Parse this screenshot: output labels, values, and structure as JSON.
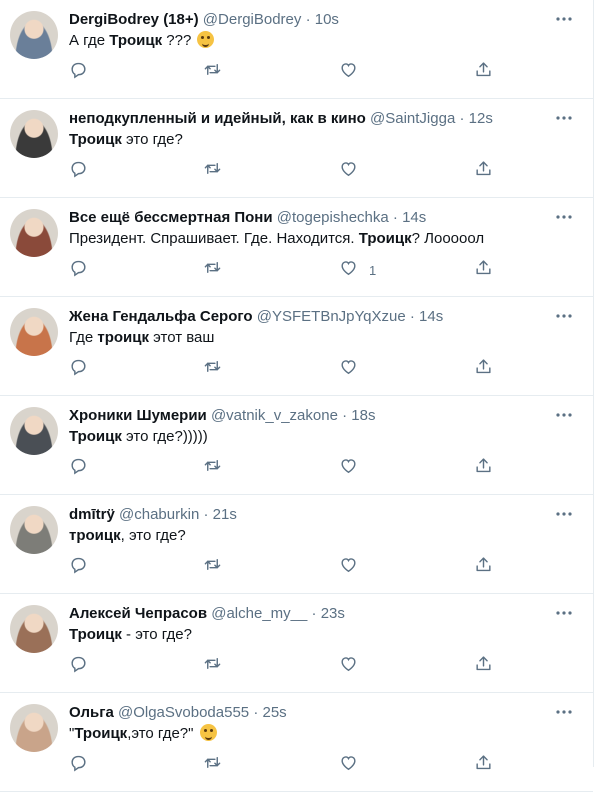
{
  "colors": {
    "name": "#0f1419",
    "muted": "#5b7083",
    "divider": "#e6ecf0",
    "emoji": "#f6c343"
  },
  "tweets": [
    {
      "name": "DergiBodrey (18+)",
      "handle": "@DergiBodrey",
      "time": "10s",
      "text_before": "А где ",
      "text_bold": "Троицк",
      "text_after": " ???",
      "emoji": "thinking-face-emoji",
      "likes": "",
      "avatar": "#6a7f99"
    },
    {
      "name": "неподкупленный и идейный, как в кино",
      "handle": "@SaintJigga",
      "time": "12s",
      "text_before": "",
      "text_bold": "Троицк",
      "text_after": " это где?",
      "likes": "",
      "avatar": "#3a3a3a"
    },
    {
      "name": "Все ещё бессмертная Пони",
      "handle": "@togepishechka",
      "time": "14s",
      "text_before": "Президент. Спрашивает. Где. Находится. ",
      "text_bold": "Троицк",
      "text_after": "? Лооооол",
      "likes": "1",
      "avatar": "#8a4a3a"
    },
    {
      "name": "Жена Гендальфа Серого",
      "handle": "@YSFETBnJpYqXzue",
      "time": "14s",
      "text_before": "Где ",
      "text_bold": "троицк",
      "text_after": " этот ваш",
      "likes": "",
      "avatar": "#c8744a"
    },
    {
      "name": "Хроники Шумерии",
      "handle": "@vatnik_v_zakone",
      "time": "18s",
      "text_before": "",
      "text_bold": "Троицк",
      "text_after": " это где?)))))",
      "likes": "",
      "avatar": "#4a4f55"
    },
    {
      "name": "dmītrÿ",
      "handle": "@chaburkin",
      "time": "21s",
      "text_before": "",
      "text_bold": "троицк",
      "text_after": ", это где?",
      "likes": "",
      "avatar": "#7d7d78"
    },
    {
      "name": "Алексей Чепрасов",
      "handle": "@alche_my__",
      "time": "23s",
      "text_before": "",
      "text_bold": "Троицк",
      "text_after": " - это где?",
      "likes": "",
      "avatar": "#9a7058"
    },
    {
      "name": "Ольга",
      "handle": "@OlgaSvoboda555",
      "time": "25s",
      "text_before": "\"",
      "text_bold": "Троицк",
      "text_after": ",это где?\"",
      "emoji": "rofl-emoji",
      "likes": "",
      "avatar": "#c9a48a"
    }
  ],
  "icons": {
    "reply": "reply-icon",
    "retweet": "retweet-icon",
    "like": "like-icon",
    "share": "share-icon",
    "more": "more-icon"
  }
}
